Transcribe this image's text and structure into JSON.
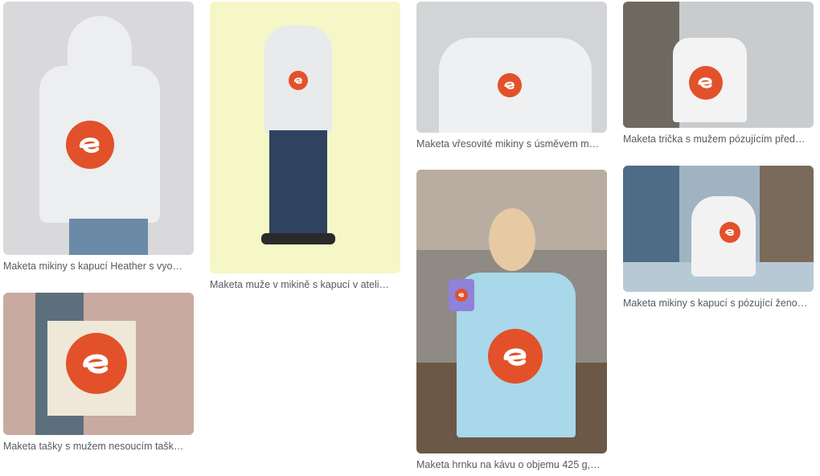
{
  "gallery": {
    "items": [
      {
        "caption": "Maketa mikiny s kapucí Heather s vyo…"
      },
      {
        "caption": "Maketa muže v mikině s kapucí v ateli…"
      },
      {
        "caption": "Maketa vřesovité mikiny s úsměvem m…"
      },
      {
        "caption": "Maketa trička s mužem pózujícím před…"
      },
      {
        "caption": "Maketa tašky s mužem nesoucím tašk…"
      },
      {
        "caption": "Maketa hrnku na kávu o objemu 425 g,…"
      },
      {
        "caption": "Maketa mikiny s kapucí s pózující ženo…"
      }
    ]
  },
  "colors": {
    "brand_logo": "#e2512a",
    "caption_text": "#555a60"
  },
  "icons": {
    "logo": "brand-e-logo-icon"
  }
}
